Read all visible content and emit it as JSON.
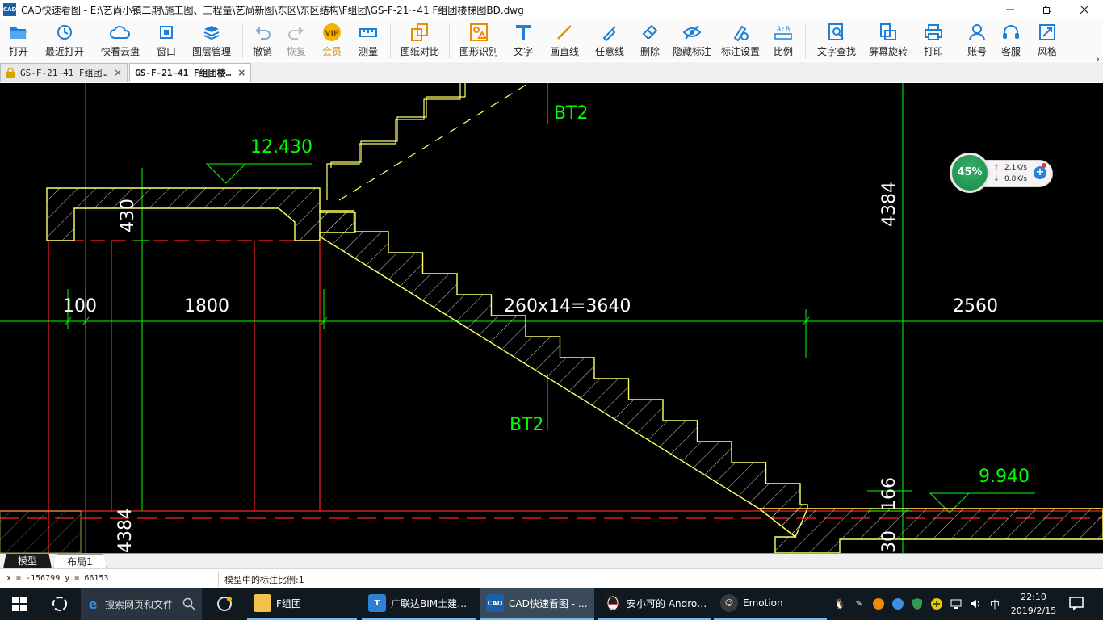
{
  "window": {
    "title": "CAD快速看图 - E:\\艺尚小镇二期\\施工图、工程量\\艺尚新图\\东区\\东区结构\\F组团\\GS-F-21~41 F组团楼梯图BD.dwg",
    "app_icon_text": "CAD"
  },
  "toolbar": {
    "items": [
      {
        "label": "打开",
        "icon": "folder-open-icon"
      },
      {
        "label": "最近打开",
        "icon": "recent-clock-icon"
      },
      {
        "label": "快看云盘",
        "icon": "cloud-icon"
      },
      {
        "label": "窗口",
        "icon": "window-icon"
      },
      {
        "label": "图层管理",
        "icon": "layers-icon"
      },
      {
        "label": "撤销",
        "icon": "undo-icon"
      },
      {
        "label": "恢复",
        "icon": "redo-icon"
      },
      {
        "label": "会员",
        "icon": "vip-icon",
        "badge": "VIP"
      },
      {
        "label": "测量",
        "icon": "ruler-icon"
      },
      {
        "label": "图纸对比",
        "icon": "compare-icon"
      },
      {
        "label": "图形识别",
        "icon": "shape-recognize-icon"
      },
      {
        "label": "文字",
        "icon": "text-icon"
      },
      {
        "label": "画直线",
        "icon": "line-icon"
      },
      {
        "label": "任意线",
        "icon": "freehand-icon"
      },
      {
        "label": "删除",
        "icon": "eraser-icon"
      },
      {
        "label": "隐藏标注",
        "icon": "hide-eye-icon"
      },
      {
        "label": "标注设置",
        "icon": "annotation-settings-icon"
      },
      {
        "label": "比例",
        "icon": "scale-icon",
        "badge": "A:B"
      },
      {
        "label": "文字查找",
        "icon": "text-search-icon"
      },
      {
        "label": "屏幕旋转",
        "icon": "rotate-screen-icon"
      },
      {
        "label": "打印",
        "icon": "printer-icon"
      },
      {
        "label": "账号",
        "icon": "account-icon"
      },
      {
        "label": "客服",
        "icon": "headset-icon"
      },
      {
        "label": "风格",
        "icon": "style-icon"
      }
    ],
    "more": "›"
  },
  "doc_tabs": [
    {
      "label": "GS-F-21~41 F组团…",
      "close": "×",
      "active": false
    },
    {
      "label": "GS-F-21~41 F组团楼…",
      "close": "×",
      "active": true
    }
  ],
  "drawing": {
    "texts": {
      "bt2_top": "BT2",
      "bt2_mid": "BT2",
      "elev_top": "12.430",
      "elev_bottom": "9.940",
      "dim_430": "430",
      "dim_4384": "4384",
      "dim_4384_left": "4384",
      "dim_100": "100",
      "dim_1800": "1800",
      "dim_stairs": "260x14=3640",
      "dim_2560": "2560",
      "dim_166": "166",
      "dim_30": "30"
    },
    "colors": {
      "background": "#000000",
      "outline": "#ffff66",
      "dimension": "#00ff00",
      "axis": "#ff2020",
      "hatch": "#ffffff"
    }
  },
  "speed_widget": {
    "percent": "45%",
    "up": "2.1K/s",
    "down": "0.8K/s",
    "up_arrow": "↑",
    "down_arrow": "↓",
    "plus": "+"
  },
  "layout_tabs": [
    {
      "label": "模型",
      "active": true
    },
    {
      "label": "布局1",
      "active": false
    }
  ],
  "status": {
    "coords": "x = -156799  y = 66153",
    "scale": "模型中的标注比例:1"
  },
  "taskbar": {
    "search_placeholder": "搜索网页和文件",
    "apps": [
      {
        "label": "F组团",
        "icon": "folder-icon"
      },
      {
        "label": "广联达BIM土建…",
        "icon": "glodon-icon"
      },
      {
        "label": "CAD快速看图 - …",
        "icon": "cad-app-icon"
      },
      {
        "label": "安小可的 Andro…",
        "icon": "qq-icon"
      },
      {
        "label": "Emotion",
        "icon": "emotion-icon"
      }
    ],
    "ime": "中",
    "time": "22:10",
    "date": "2019/2/15"
  }
}
